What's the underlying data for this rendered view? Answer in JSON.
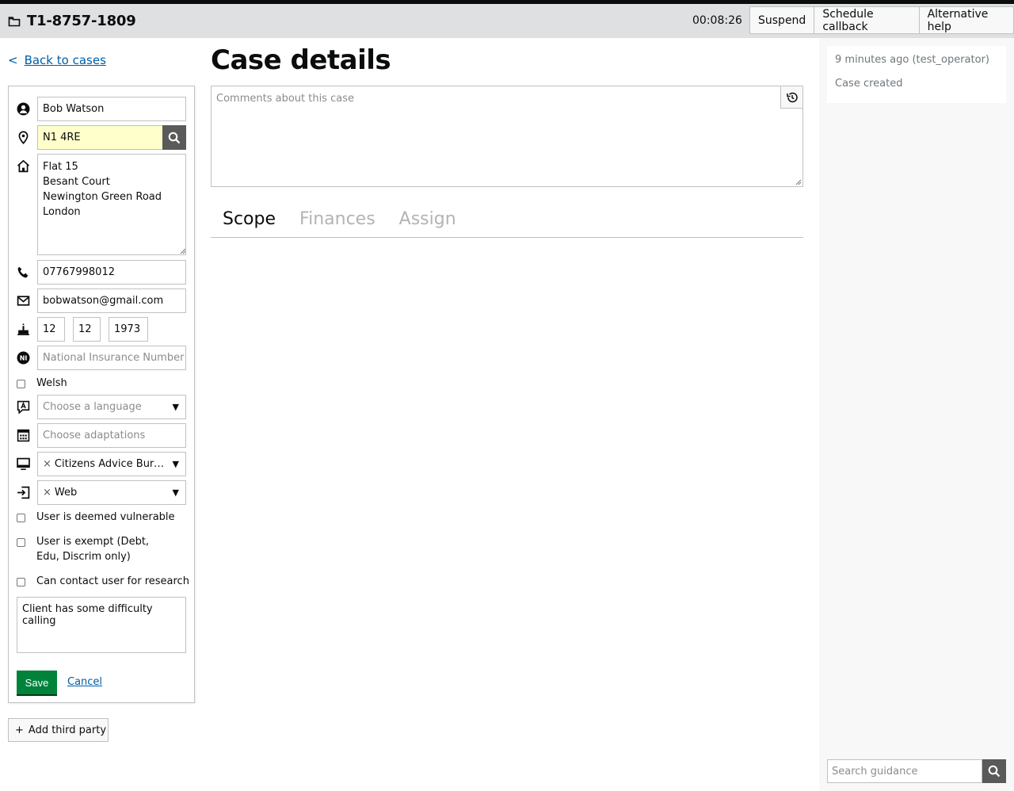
{
  "header": {
    "case_ref": "T1-8757-1809",
    "timer": "00:08:26",
    "actions": [
      "Suspend",
      "Schedule callback",
      "Alternative help"
    ]
  },
  "nav": {
    "back_chevron": "<",
    "back_label": "Back to cases"
  },
  "person": {
    "full_name": "Bob Watson",
    "postcode": "N1 4RE",
    "address": "Flat 15\nBesant Court\nNewington Green Road\nLondon",
    "mobile": "07767998012",
    "email": "bobwatson@gmail.com",
    "dob_day": "12",
    "dob_month": "12",
    "dob_year": "1973",
    "ni_placeholder": "National Insurance Number",
    "welsh_label": "Welsh",
    "language_placeholder": "Choose a language",
    "adaptations_placeholder": "Choose adaptations",
    "media_code": "Citizens Advice Bure…",
    "contact_method": "Web",
    "remove_symbol": "×",
    "vulnerable_label": "User is deemed vulnerable",
    "exempt_label": "User is exempt (Debt, Edu, Discrim only)",
    "research_label": "Can contact user for research",
    "notes": "Client has some difficulty calling",
    "save_label": "Save",
    "cancel_label": "Cancel"
  },
  "third_party": {
    "plus": "+",
    "label": "Add third party"
  },
  "main": {
    "title": "Case details",
    "comments_placeholder": "Comments about this case",
    "tabs": [
      "Scope",
      "Finances",
      "Assign"
    ]
  },
  "sidebar": {
    "event_meta": "9 minutes ago (test_operator)",
    "event_text": "Case created",
    "guidance_placeholder": "Search guidance"
  },
  "icons": {
    "folder": "folder-icon",
    "user": "user-icon",
    "pin": "map-pin-icon",
    "home": "home-icon",
    "phone": "phone-icon",
    "mail": "mail-icon",
    "cake": "birthday-icon",
    "ni": "ni-icon",
    "lang": "language-icon",
    "adapt": "adaptations-icon",
    "media": "monitor-icon",
    "method": "sign-in-icon",
    "search": "search-icon",
    "history": "history-icon"
  },
  "colors": {
    "accent_link": "#005ea5",
    "save_green": "#00823b",
    "postcode_highlight": "#ffffcc"
  }
}
